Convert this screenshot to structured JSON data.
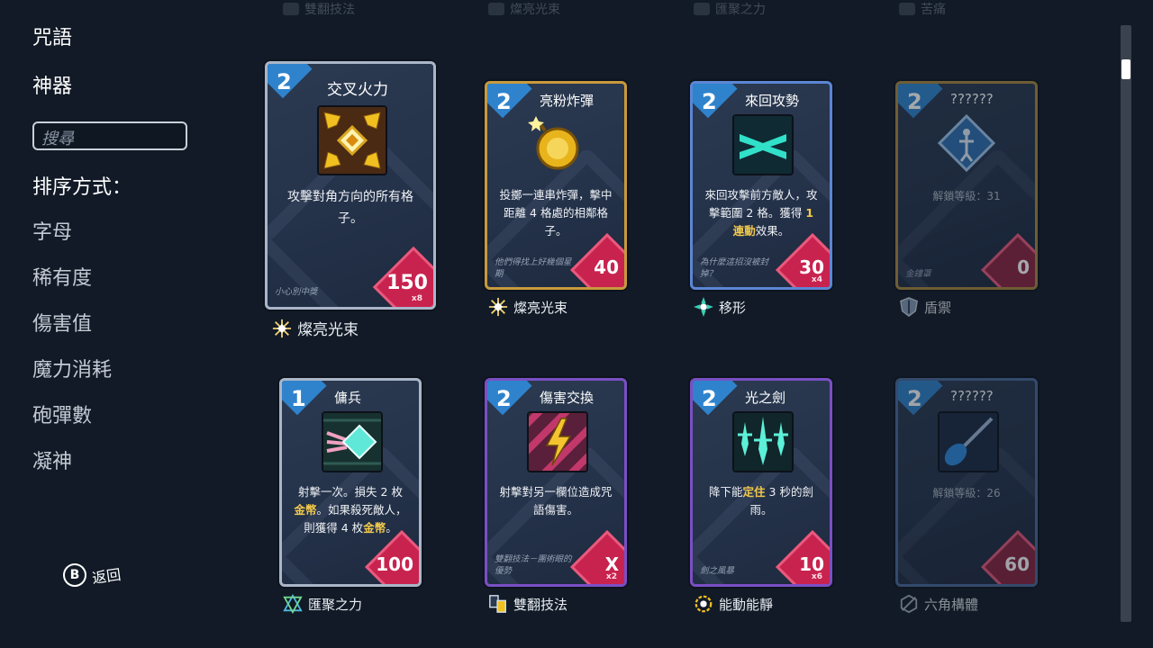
{
  "sidebar": {
    "spells_label": "咒語",
    "artifacts_label": "神器",
    "search_placeholder": "搜尋",
    "sort_title": "排序方式：",
    "sort_items": [
      "字母",
      "稀有度",
      "傷害值",
      "魔力消耗",
      "砲彈數",
      "凝神"
    ],
    "back_button_glyph": "B",
    "back_label": "返回"
  },
  "top_row": [
    "雙翻技法",
    "燦亮光束",
    "匯聚之力",
    "苦痛"
  ],
  "cards": [
    {
      "level": "2",
      "title": "交叉火力",
      "desc": "攻擊對角方向的所有格子。",
      "flavor": "小心別中獎",
      "cost": "150",
      "mult": "x8",
      "set": "燦亮光束"
    },
    {
      "level": "2",
      "title": "亮粉炸彈",
      "desc": "投擲一連串炸彈，擊中距離 4 格處的相鄰格子。",
      "flavor": "他們得找上好幾個星期",
      "cost": "40",
      "mult": "",
      "set": "燦亮光束"
    },
    {
      "level": "2",
      "title": "來回攻勢",
      "desc_a": "來回攻擊前方敵人，攻擊範圍 2 格。獲得 ",
      "desc_hl": "1 連動",
      "desc_b": "效果。",
      "flavor": "為什麼這招沒被封掉？",
      "cost": "30",
      "mult": "x4",
      "set": "移形"
    },
    {
      "level": "2",
      "title": "??????",
      "lock": "解鎖等級：31",
      "flavor": "金鐘罩",
      "cost": "0",
      "mult": "",
      "set": "盾禦"
    },
    {
      "level": "1",
      "title": "傭兵",
      "desc_a": "射擊一次。損失 2 枚",
      "desc_hl1": "金幣",
      "desc_b": "。如果殺死敵人，則獲得 4 枚",
      "desc_hl2": "金幣",
      "desc_c": "。",
      "cost": "100",
      "mult": "",
      "set": "匯聚之力"
    },
    {
      "level": "2",
      "title": "傷害交換",
      "desc": "射擊對另一欄位造成咒語傷害。",
      "flavor": "雙翻技法－團術眼的優勢",
      "cost": "X",
      "mult": "x2",
      "set": "雙翻技法"
    },
    {
      "level": "2",
      "title": "光之劍",
      "desc_a": "降下能",
      "desc_hl": "定住",
      "desc_b": " 3 秒的劍雨。",
      "flavor": "劍之風暴",
      "cost": "10",
      "mult": "x6",
      "set": "能動能靜"
    },
    {
      "level": "2",
      "title": "??????",
      "lock": "解鎖等級：26",
      "cost": "60",
      "mult": "",
      "set": "六角構體"
    }
  ],
  "colors": {
    "background": "#111a26",
    "level_badge": "#2f83cc",
    "cost_badge": "#c8234f",
    "highlight": "#f2c94c"
  }
}
